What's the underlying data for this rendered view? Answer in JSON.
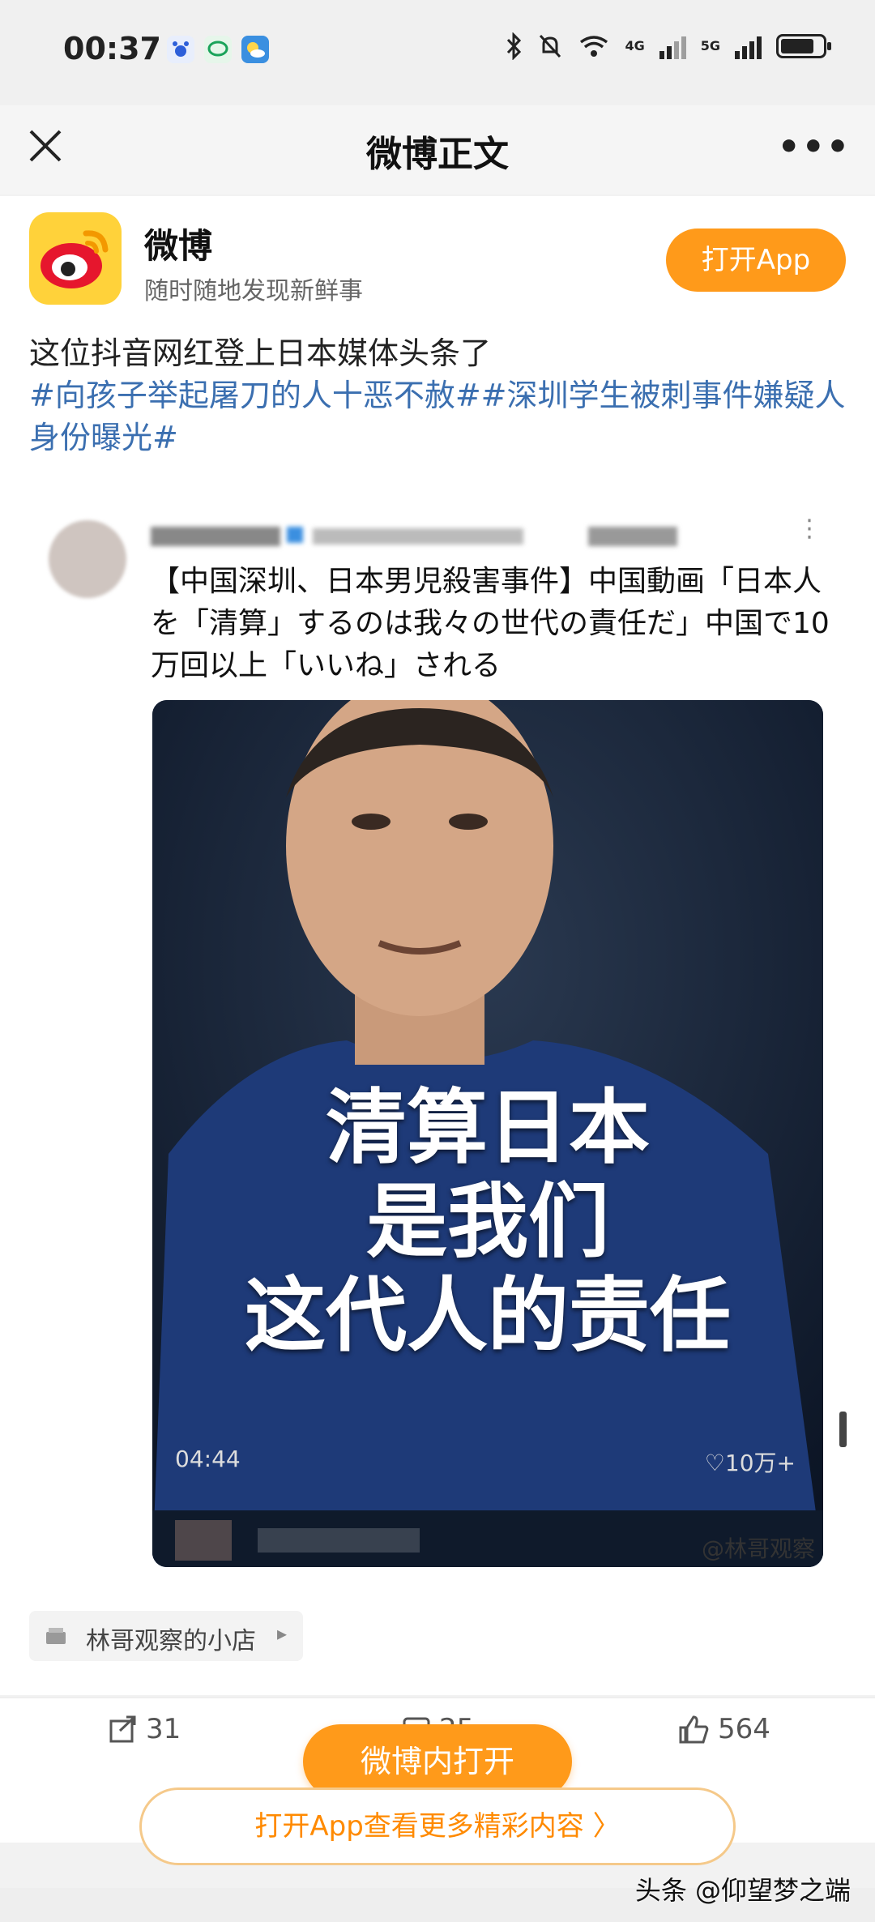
{
  "status_bar": {
    "time": "00:37",
    "network_1": "4G",
    "network_2": "5G",
    "icons": [
      "baidu-icon",
      "chat-icon",
      "weather-icon",
      "bluetooth-icon",
      "mute-bell-icon",
      "wifi-icon",
      "signal-icon",
      "battery-icon"
    ]
  },
  "nav": {
    "title": "微博正文",
    "close_icon": "close-icon",
    "more_label": "•••"
  },
  "app_banner": {
    "name": "微博",
    "subtitle": "随时随地发现新鲜事",
    "open_label": "打开App"
  },
  "post": {
    "text": "这位抖音网红登上日本媒体头条了",
    "hashtags": "#向孩子举起屠刀的人十恶不赦##深圳学生被刺事件嫌疑人身份曝光#"
  },
  "embedded": {
    "text": "【中国深圳、日本男児殺害事件】中国動画「日本人を「清算」するのは我々の世代の責任だ」中国で10万回以上「いいね」される",
    "overlay_line1": "清算日本",
    "overlay_line2": "是我们",
    "overlay_line3": "这代人的责任",
    "video_time": "04:44",
    "video_likes": "♡10万+",
    "watermark": "@林哥观察"
  },
  "shop": {
    "label": "林哥观察的小店",
    "arrow": "▸"
  },
  "actions": {
    "share_count": "31",
    "comment_count": "25",
    "like_count": "564"
  },
  "float_button": "微博内打开",
  "more_content_button": "打开App查看更多精彩内容 〉",
  "credit": "头条 @仰望梦之端",
  "colors": {
    "accent": "#ff9a1a",
    "hashtag": "#3b6fb0",
    "weibo_red": "#e6162d"
  }
}
